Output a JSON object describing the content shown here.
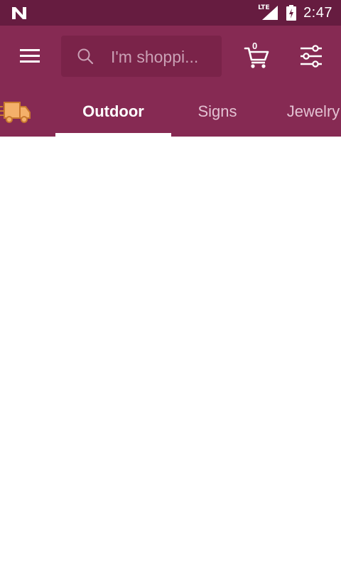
{
  "status_bar": {
    "time": "2:47",
    "network_label": "LTE",
    "icons": [
      "n-notification-icon",
      "lte-signal-icon",
      "battery-charging-icon"
    ]
  },
  "toolbar": {
    "search_placeholder": "I'm shoppi...",
    "cart_count": "0",
    "icons": [
      "menu-icon",
      "search-icon",
      "cart-icon",
      "filter-sliders-icon"
    ]
  },
  "tabs": {
    "items": [
      {
        "label": "Outdoor",
        "active": true
      },
      {
        "label": "Signs",
        "active": false
      },
      {
        "label": "Jewelry",
        "active": false
      }
    ],
    "leading_icon": "delivery-truck-icon"
  },
  "colors": {
    "status_bar_bg": "#661c40",
    "app_bar_bg": "#862a53",
    "search_bg": "#7a2349",
    "tab_inactive_text": "#e3c1d2",
    "truck_fill": "#f4b06a"
  }
}
